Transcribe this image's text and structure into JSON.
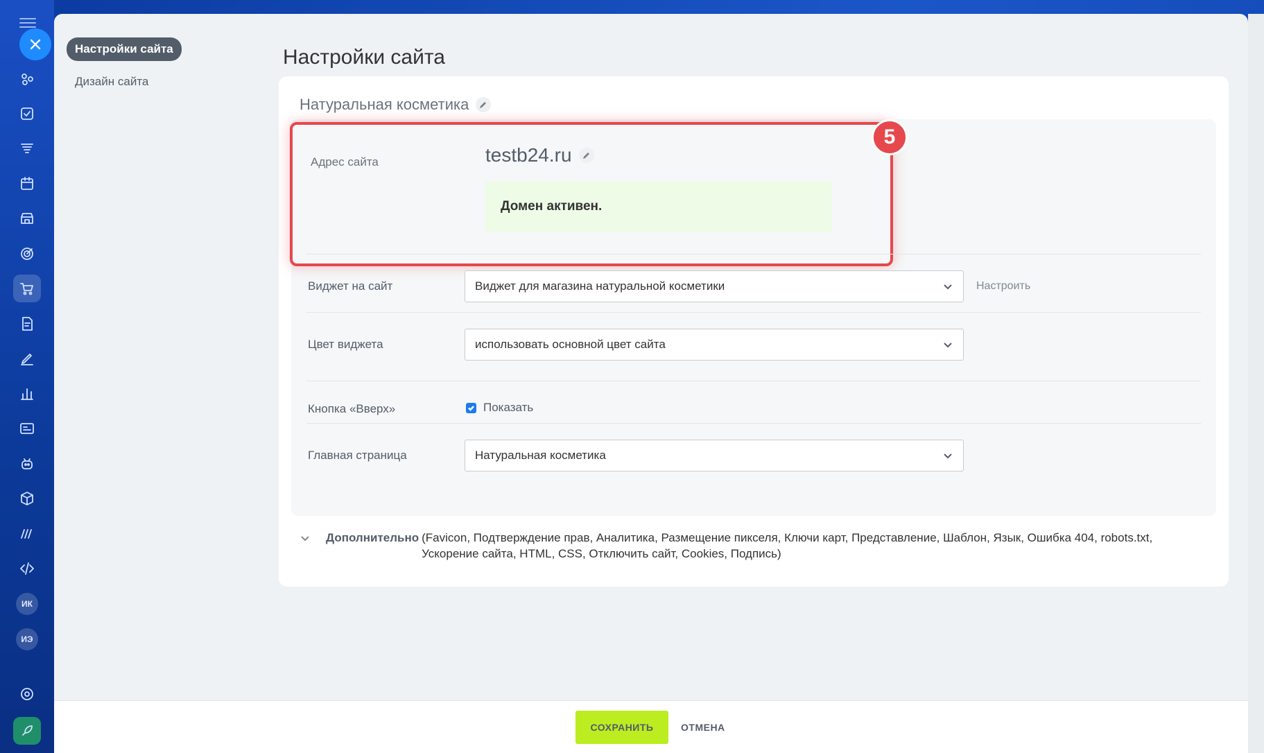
{
  "sidebar": {
    "active": "Настройки сайта",
    "items": [
      "Дизайн сайта"
    ]
  },
  "rail": {
    "avatars": [
      "ИК",
      "ИЭ"
    ],
    "icons": [
      "menu-icon",
      "close-icon",
      "crm-icon",
      "tasks-icon",
      "funnel-icon",
      "calendar-icon",
      "store-icon",
      "target-icon",
      "cart-icon",
      "document-icon",
      "sign-icon",
      "analytics-icon",
      "contact-card-icon",
      "robot-icon",
      "box-icon",
      "marketing-icon",
      "code-icon",
      "settings-icon",
      "rocket-icon"
    ]
  },
  "page": {
    "title": "Настройки сайта",
    "site_name": "Натуральная косметика"
  },
  "address": {
    "label": "Адрес сайта",
    "value": "testb24.ru",
    "status": "Домен активен."
  },
  "step_badge": "5",
  "rows": {
    "widget": {
      "label": "Виджет на сайт",
      "value": "Виджет для магазина натуральной косметики",
      "configure": "Настроить"
    },
    "color": {
      "label": "Цвет виджета",
      "value": "использовать основной цвет сайта"
    },
    "up_button": {
      "label": "Кнопка «Вверх»",
      "checkbox_label": "Показать",
      "checked": true
    },
    "home": {
      "label": "Главная страница",
      "value": "Натуральная косметика"
    }
  },
  "more": {
    "title": "Дополнительно",
    "list": "(Favicon,  Подтверждение прав,  Аналитика,  Размещение пикселя,  Ключи карт,  Представление,  Шаблон,  Язык,  Ошибка 404,  robots.txt,  Ускорение сайта,  HTML,  CSS,  Отключить сайт,  Cookies,  Подпись)"
  },
  "footer": {
    "save": "СОХРАНИТЬ",
    "cancel": "ОТМЕНА"
  },
  "colors": {
    "accent": "#1e8bff",
    "save_button": "#bbed21",
    "highlight": "#e5484d",
    "success_bg": "#eefbe6"
  }
}
